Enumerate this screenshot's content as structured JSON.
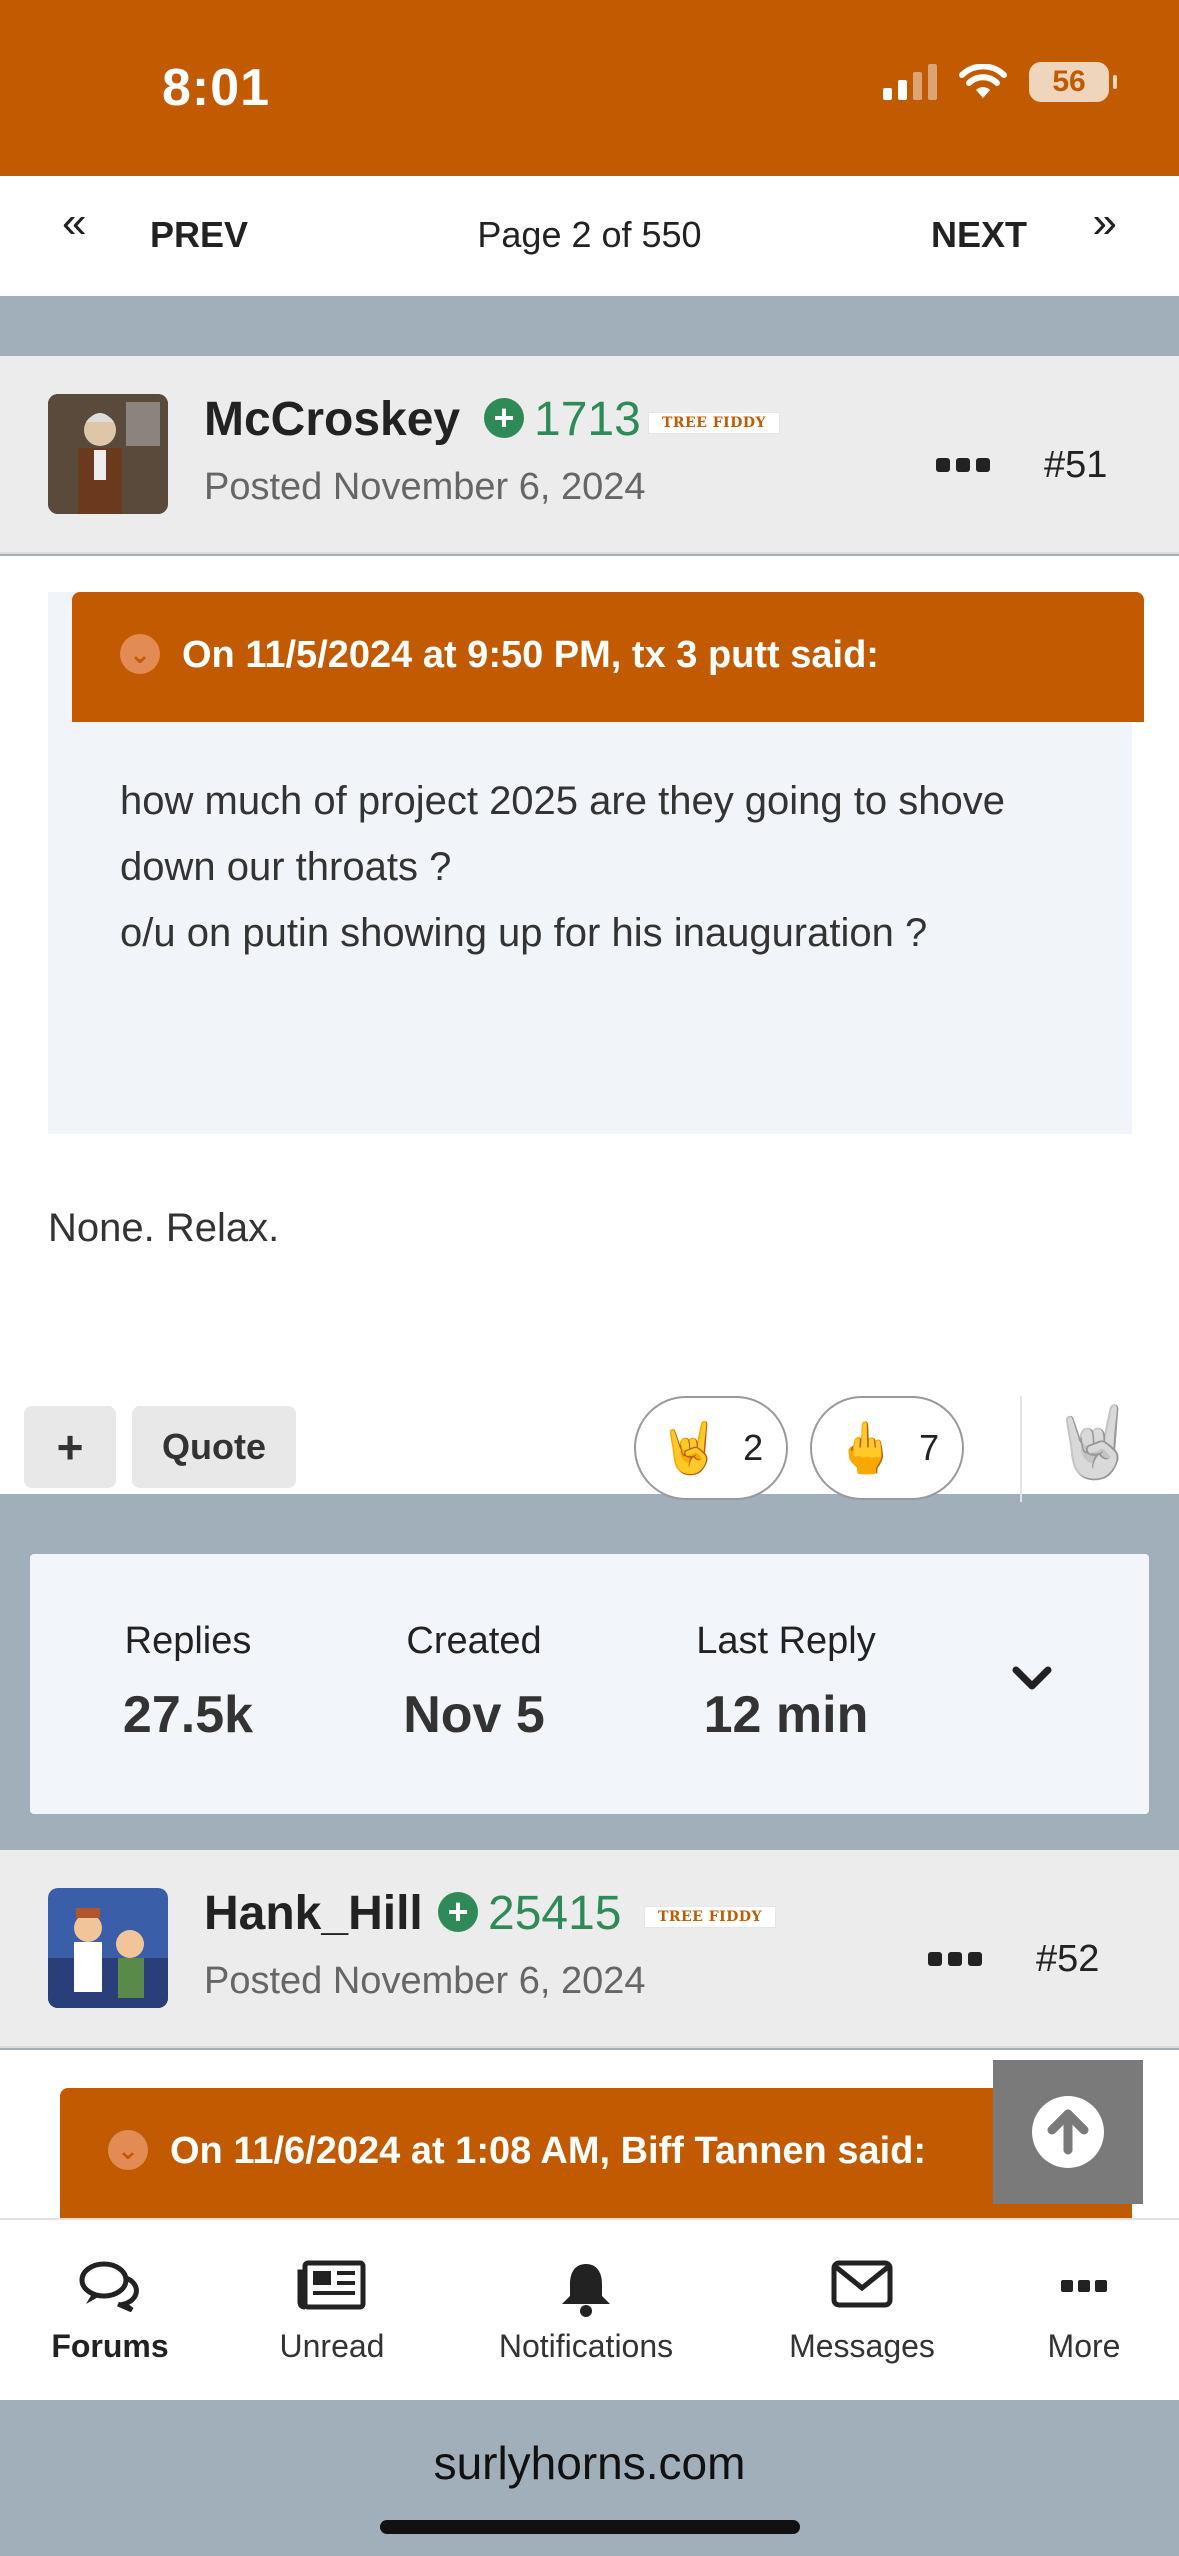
{
  "status_bar": {
    "time": "8:01",
    "battery": "56"
  },
  "pager": {
    "prev_label": "PREV",
    "next_label": "NEXT",
    "page_info": "Page 2 of 550"
  },
  "posts": [
    {
      "author": "McCroskey",
      "reputation": "1713",
      "badge": "TREE FIDDY",
      "posted": "Posted November 6, 2024",
      "number": "#51",
      "quote": {
        "title": "On 11/5/2024 at 9:50 PM, tx 3 putt said:",
        "lines": [
          "how much of project 2025 are they going to shove down our throats ?",
          "o/u on putin showing up for his inauguration ?"
        ]
      },
      "reply": "None. Relax.",
      "actions": {
        "plus": "+",
        "quote": "Quote"
      },
      "reactions": [
        {
          "icon": "rock-on-hand-icon",
          "count": "2"
        },
        {
          "icon": "middle-finger-icon",
          "count": "7"
        }
      ]
    },
    {
      "author": "Hank_Hill",
      "reputation": "25415",
      "badge": "TREE FIDDY",
      "posted": "Posted November 6, 2024",
      "number": "#52",
      "quote": {
        "title": "On 11/6/2024 at 1:08 AM, Biff Tannen said:"
      }
    }
  ],
  "stats": {
    "replies_label": "Replies",
    "replies_value": "27.5k",
    "created_label": "Created",
    "created_value": "Nov 5",
    "last_label": "Last Reply",
    "last_value": "12 min"
  },
  "bottom_nav": [
    {
      "label": "Forums",
      "icon": "forums-icon",
      "active": true
    },
    {
      "label": "Unread",
      "icon": "newspaper-icon"
    },
    {
      "label": "Notifications",
      "icon": "bell-icon"
    },
    {
      "label": "Messages",
      "icon": "envelope-icon"
    },
    {
      "label": "More",
      "icon": "more-dots-icon"
    }
  ],
  "domain": "surlyhorns.com",
  "colors": {
    "brand": "#c15a00",
    "reputation": "#2e8b57",
    "background": "#a0afba"
  }
}
